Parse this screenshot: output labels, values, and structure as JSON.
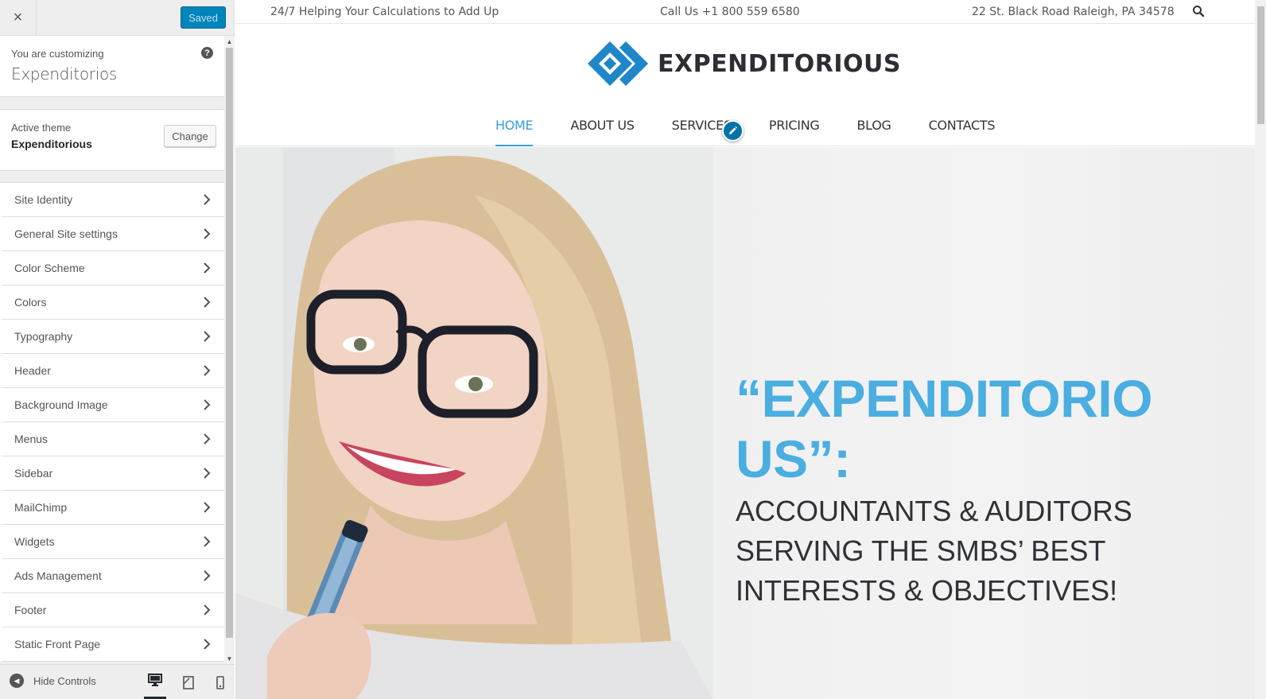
{
  "customizer": {
    "close_label": "×",
    "save_button": "Saved",
    "customizing_label": "You are customizing",
    "site_name": "Expenditorios",
    "help_label": "?",
    "active_theme_label": "Active theme",
    "active_theme_name": "Expenditorious",
    "change_button": "Change",
    "sections": [
      {
        "label": "Site Identity"
      },
      {
        "label": "General Site settings"
      },
      {
        "label": "Color Scheme"
      },
      {
        "label": "Colors"
      },
      {
        "label": "Typography"
      },
      {
        "label": "Header"
      },
      {
        "label": "Background Image"
      },
      {
        "label": "Menus"
      },
      {
        "label": "Sidebar"
      },
      {
        "label": "MailChimp"
      },
      {
        "label": "Widgets"
      },
      {
        "label": "Ads Management"
      },
      {
        "label": "Footer"
      },
      {
        "label": "Static Front Page"
      }
    ],
    "hide_controls": "Hide Controls",
    "devices": [
      "desktop-icon",
      "tablet-icon",
      "mobile-icon"
    ]
  },
  "preview": {
    "topbar": {
      "tagline": "24/7 Helping Your Calculations to Add Up",
      "phone": "Call Us +1 800 559 6580",
      "address": "22 St. Black Road Raleigh, PA 34578"
    },
    "logo_text": "EXPENDITORIOUS",
    "nav": [
      {
        "label": "HOME",
        "active": true
      },
      {
        "label": "ABOUT US",
        "active": false
      },
      {
        "label": "SERVICES",
        "active": false
      },
      {
        "label": "PRICING",
        "active": false
      },
      {
        "label": "BLOG",
        "active": false
      },
      {
        "label": "CONTACTS",
        "active": false
      }
    ],
    "hero": {
      "title": "“EXPENDITORIOUS”:",
      "subtitle": "ACCOUNTANTS & AUDITORS SERVING THE SMBS’ BEST INTERESTS & OBJECTIVES!"
    }
  },
  "colors": {
    "wp_blue": "#0085ba",
    "accent": "#3a9fd6",
    "hero_title": "#4aaee0",
    "hero_text": "#2f3136"
  }
}
